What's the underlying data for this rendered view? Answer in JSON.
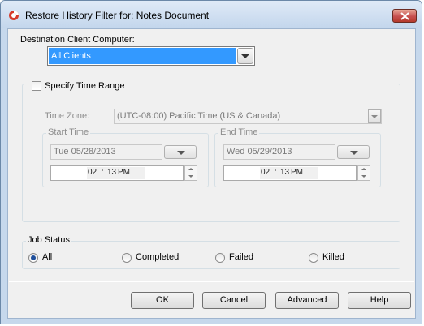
{
  "window": {
    "title": "Restore History Filter for: Notes Document"
  },
  "destination": {
    "label": "Destination Client Computer:",
    "selected": "All Clients"
  },
  "time_range": {
    "checkbox_label": "Specify Time Range",
    "checked": false,
    "timezone_label": "Time Zone:",
    "timezone_value": "(UTC-08:00) Pacific Time (US & Canada)",
    "start": {
      "label": "Start Time",
      "date": "Tue 05/28/2013",
      "hour": "02",
      "sep": ":",
      "minute": "13",
      "ampm": "PM"
    },
    "end": {
      "label": "End Time",
      "date": "Wed 05/29/2013",
      "hour": "02",
      "sep": ":",
      "minute": "13",
      "ampm": "PM"
    }
  },
  "job_status": {
    "label": "Job Status",
    "options": [
      "All",
      "Completed",
      "Failed",
      "Killed"
    ],
    "selected": "All"
  },
  "buttons": {
    "ok": "OK",
    "cancel": "Cancel",
    "advanced": "Advanced",
    "help": "Help"
  },
  "colors": {
    "selection": "#3399ff",
    "titlebar": "#c6d8ec",
    "close": "#c75050"
  }
}
